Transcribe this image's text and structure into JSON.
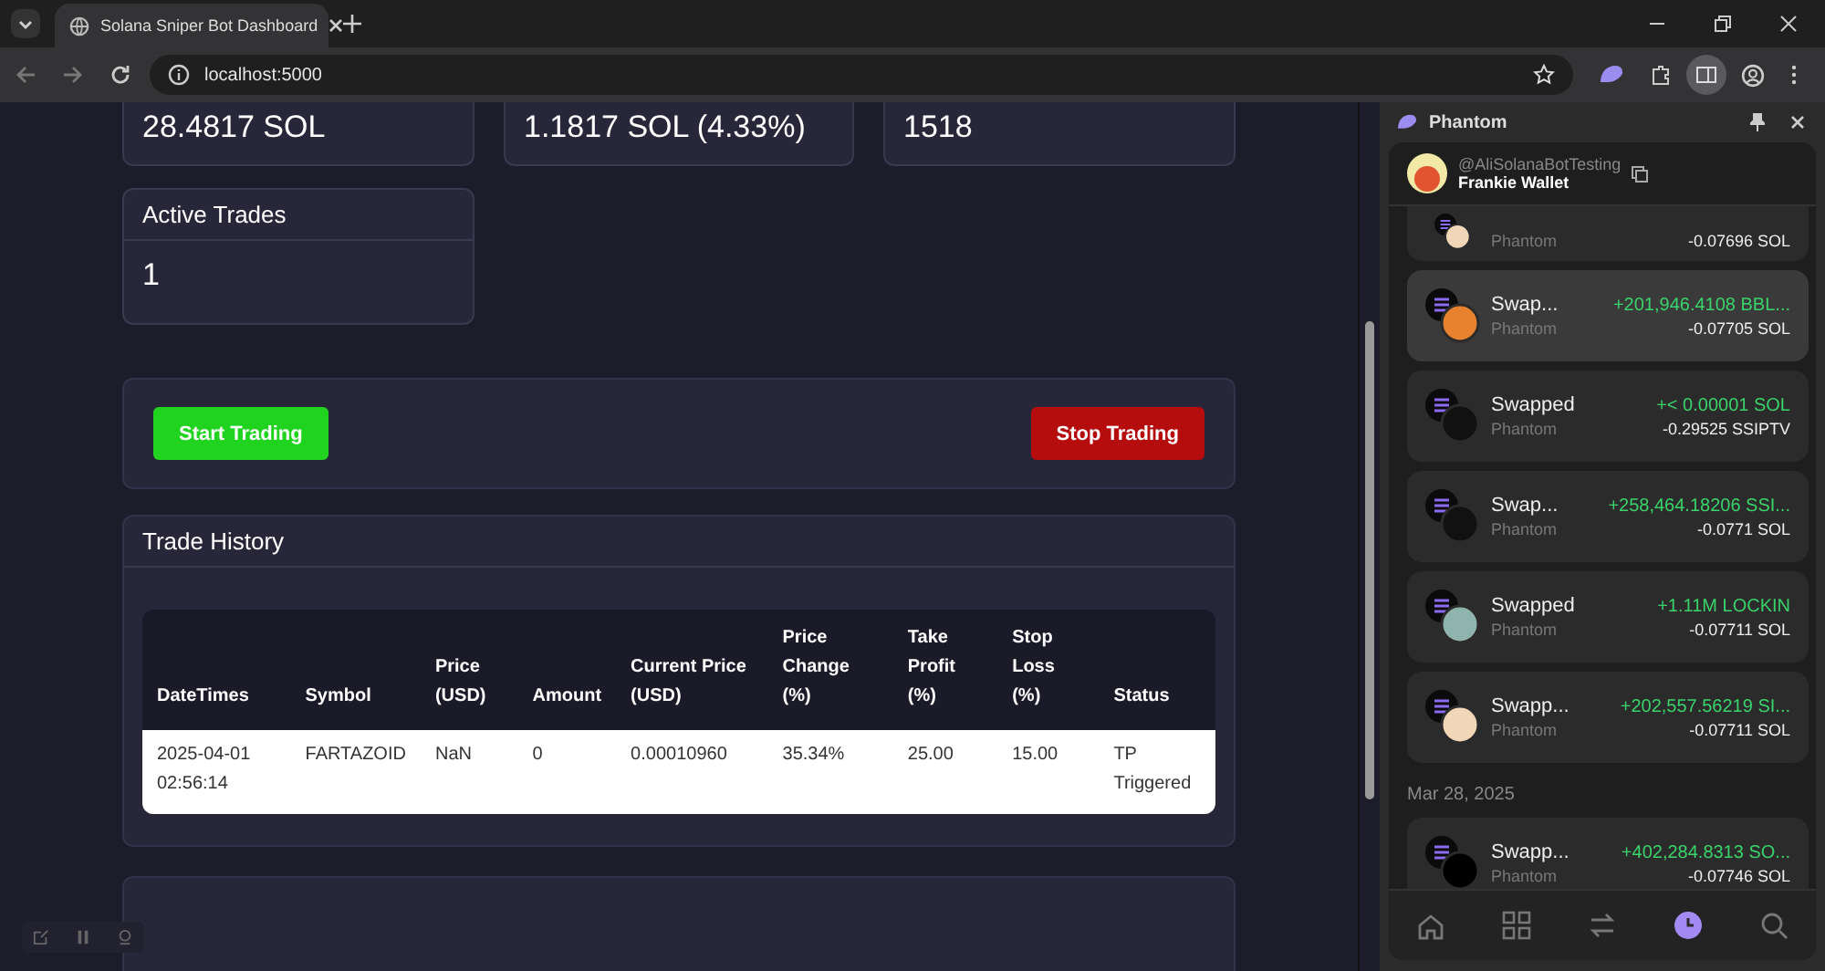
{
  "browser": {
    "tab_title": "Solana Sniper Bot Dashboard",
    "url": "localhost:5000"
  },
  "stat_cards": [
    {
      "value": "28.4817 SOL"
    },
    {
      "value": "1.1817 SOL (4.33%)"
    },
    {
      "value": "1518"
    }
  ],
  "active_trades": {
    "title": "Active Trades",
    "value": "1"
  },
  "controls": {
    "start": "Start Trading",
    "stop": "Stop Trading"
  },
  "trade_history": {
    "title": "Trade History",
    "columns": [
      "DateTimes",
      "Symbol",
      "Price (USD)",
      "Amount",
      "Current Price (USD)",
      "Price Change (%)",
      "Take Profit (%)",
      "Stop Loss (%)",
      "Status"
    ],
    "rows": [
      [
        "2025-04-01 02:56:14",
        "FARTAZOID",
        "NaN",
        "0",
        "0.00010960",
        "35.34%",
        "25.00",
        "15.00",
        "TP Triggered"
      ]
    ]
  },
  "wallet_panel": {
    "title": "Phantom",
    "handle": "@AliSolanaBotTesting",
    "wallet": "Frankie Wallet",
    "items": [
      {
        "kind": "partial",
        "source": "Phantom",
        "sent": "-0.07696 SOL",
        "selected": false
      },
      {
        "kind": "tx",
        "title": "Swap...",
        "source": "Phantom",
        "received": "+201,946.4108 BBL...",
        "sent": "-0.07705 SOL",
        "selected": true
      },
      {
        "kind": "tx",
        "title": "Swapped",
        "source": "Phantom",
        "received": "+< 0.00001 SOL",
        "sent": "-0.29525 SSIPTV",
        "selected": false
      },
      {
        "kind": "tx",
        "title": "Swap...",
        "source": "Phantom",
        "received": "+258,464.18206 SSI...",
        "sent": "-0.0771 SOL",
        "selected": false
      },
      {
        "kind": "tx",
        "title": "Swapped",
        "source": "Phantom",
        "received": "+1.11M LOCKIN",
        "sent": "-0.07711 SOL",
        "selected": false
      },
      {
        "kind": "tx",
        "title": "Swapp...",
        "source": "Phantom",
        "received": "+202,557.56219 SI...",
        "sent": "-0.07711 SOL",
        "selected": false
      },
      {
        "kind": "date",
        "title": "Mar 28, 2025"
      },
      {
        "kind": "tx",
        "title": "Swapp...",
        "source": "Phantom",
        "received": "+402,284.8313 SO...",
        "sent": "-0.07746 SOL",
        "selected": false
      }
    ],
    "nav": [
      {
        "selected": false
      },
      {
        "selected": false
      },
      {
        "selected": false
      },
      {
        "selected": true
      },
      {
        "selected": false
      }
    ]
  }
}
